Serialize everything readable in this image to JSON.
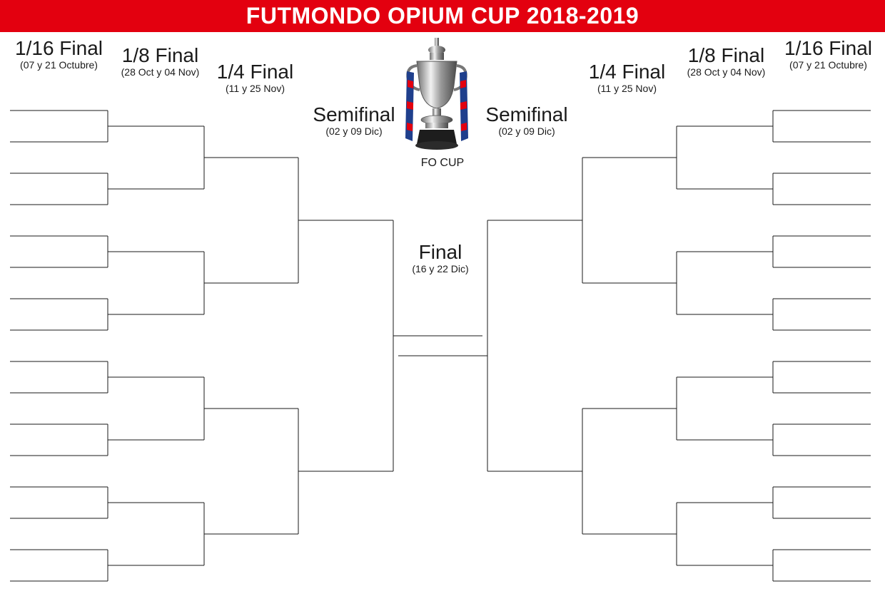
{
  "title": "FUTMONDO OPIUM CUP 2018-2019",
  "colors": {
    "title_bg": "#e3000f",
    "title_text": "#ffffff",
    "lines": "#1a1a1a"
  },
  "trophy": {
    "icon": "fa-cup-trophy-icon",
    "caption": "FO CUP"
  },
  "rounds": {
    "r16": {
      "name": "1/16 Final",
      "dates": "(07 y 21 Octubre)"
    },
    "r8": {
      "name": "1/8 Final",
      "dates": "(28  Oct y 04 Nov)"
    },
    "quarter": {
      "name": "1/4 Final",
      "dates": "(11 y 25 Nov)"
    },
    "semi": {
      "name": "Semifinal",
      "dates": "(02 y 09 Dic)"
    },
    "final": {
      "name": "Final",
      "dates": "(16 y 22 Dic)"
    }
  },
  "bracket": {
    "slots_per_side": 16,
    "team_slots": {
      "left": [
        "",
        "",
        "",
        "",
        "",
        "",
        "",
        "",
        "",
        "",
        "",
        "",
        "",
        "",
        "",
        ""
      ],
      "right": [
        "",
        "",
        "",
        "",
        "",
        "",
        "",
        "",
        "",
        "",
        "",
        "",
        "",
        "",
        "",
        ""
      ]
    },
    "finalists": [
      "",
      ""
    ]
  }
}
